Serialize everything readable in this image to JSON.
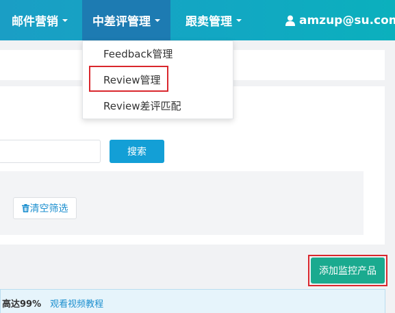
{
  "nav": {
    "items": [
      {
        "label": "邮件营销"
      },
      {
        "label": "中差评管理"
      },
      {
        "label": "跟卖管理"
      }
    ],
    "user": "amzup@su.com"
  },
  "dropdown": {
    "items": [
      {
        "label": "Feedback管理"
      },
      {
        "label": "Review管理"
      },
      {
        "label": "Review差评匹配"
      }
    ]
  },
  "search": {
    "value": "",
    "button_label": "搜索"
  },
  "filter": {
    "clear_label": "清空筛选"
  },
  "actions": {
    "add_label": "添加监控产品"
  },
  "notice": {
    "text": "高达99%",
    "link": "观看视频教程"
  },
  "colors": {
    "topbar_start": "#1a9ec5",
    "topbar_end": "#0bb0bd",
    "active_nav": "#1d7bb2",
    "primary_blue": "#139fd6",
    "add_green": "#1aaa8f",
    "highlight_red": "#d9262c",
    "link": "#1c8fcf"
  }
}
